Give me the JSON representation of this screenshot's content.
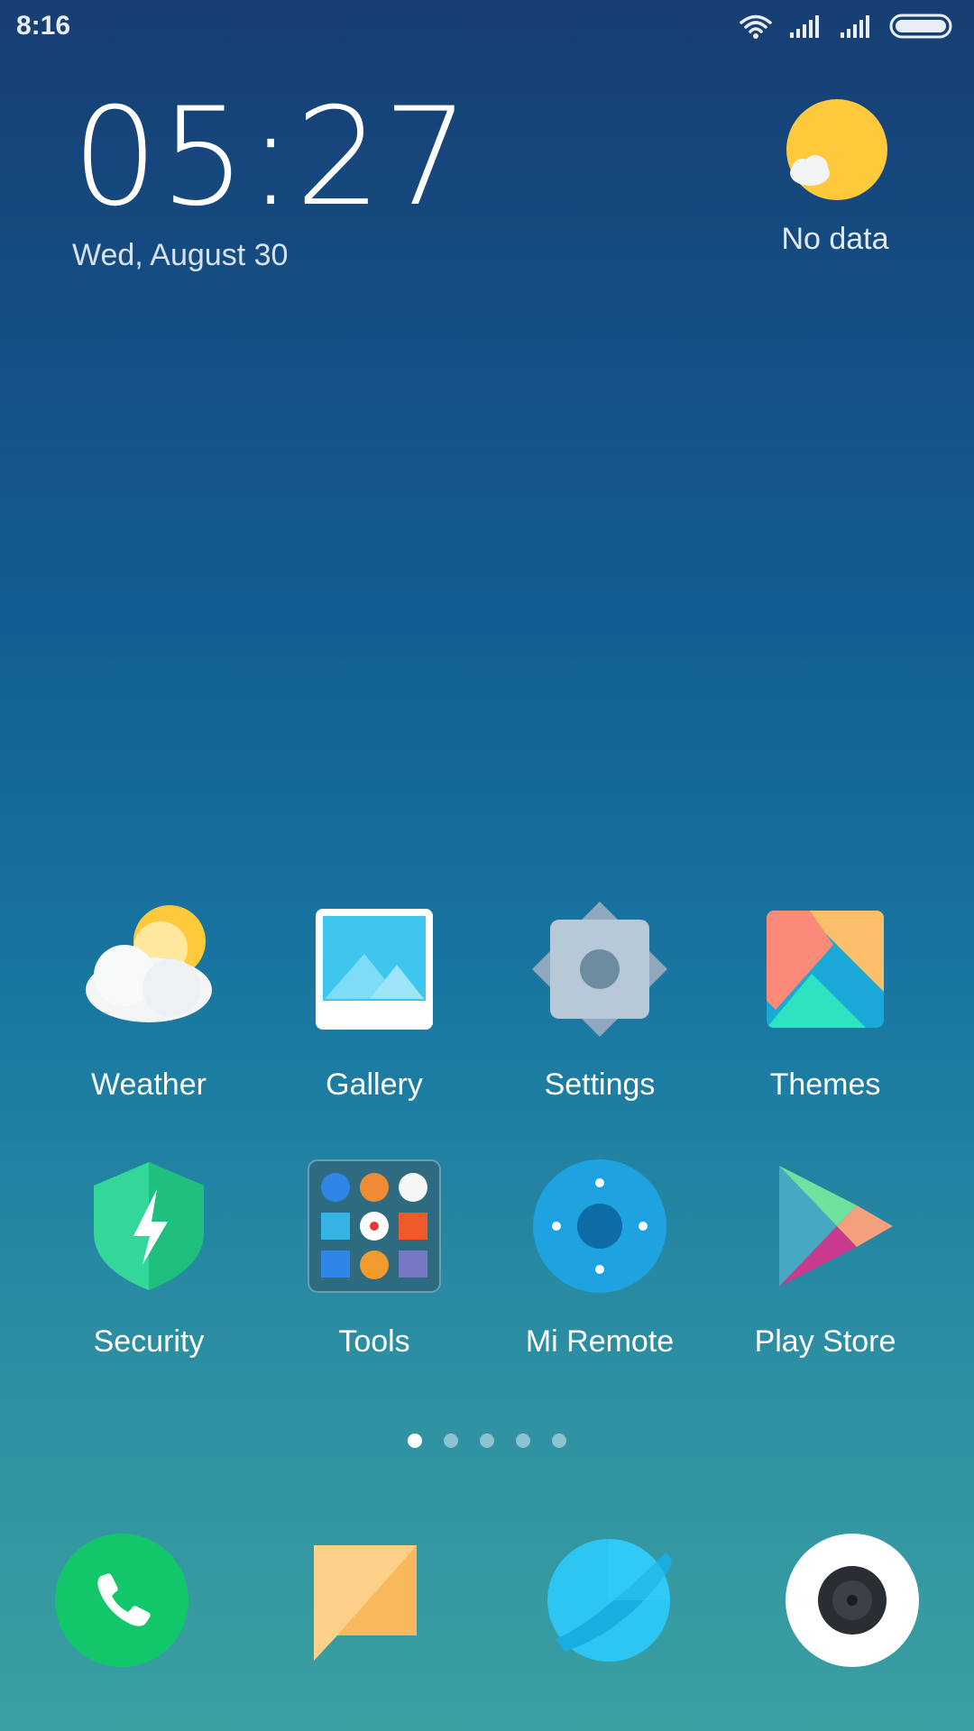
{
  "status_bar": {
    "time": "8:16",
    "icons": [
      "wifi-icon",
      "signal-icon",
      "signal-icon",
      "battery-icon"
    ]
  },
  "clock_widget": {
    "time": "05:27",
    "date": "Wed, August 30"
  },
  "weather_widget": {
    "icon": "sun-cloud-icon",
    "status": "No data"
  },
  "apps": [
    {
      "label": "Weather",
      "icon": "weather-icon"
    },
    {
      "label": "Gallery",
      "icon": "gallery-icon"
    },
    {
      "label": "Settings",
      "icon": "settings-icon"
    },
    {
      "label": "Themes",
      "icon": "themes-icon"
    },
    {
      "label": "Security",
      "icon": "security-icon"
    },
    {
      "label": "Tools",
      "icon": "tools-folder-icon"
    },
    {
      "label": "Mi Remote",
      "icon": "mi-remote-icon"
    },
    {
      "label": "Play Store",
      "icon": "play-store-icon"
    }
  ],
  "page_indicator": {
    "count": 5,
    "active_index": 0
  },
  "dock": [
    {
      "icon": "phone-icon"
    },
    {
      "icon": "messages-icon"
    },
    {
      "icon": "browser-icon"
    },
    {
      "icon": "camera-icon"
    }
  ],
  "colors": {
    "sun": "#ffc93c",
    "phone_green": "#12c76a",
    "browser_blue": "#2dc6f3",
    "security_green": "#26c98a"
  }
}
